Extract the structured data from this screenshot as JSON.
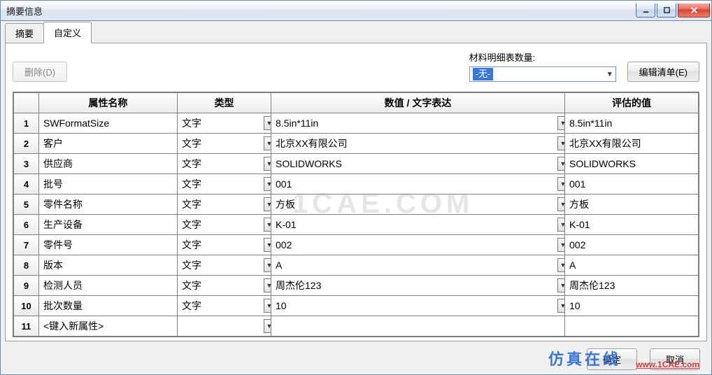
{
  "window": {
    "title": "摘要信息"
  },
  "tabs": {
    "summary": "摘要",
    "custom": "自定义"
  },
  "buttons": {
    "delete": "删除(D)",
    "edit_list": "编辑清单(E)",
    "ok": "确定",
    "cancel": "取消"
  },
  "bom": {
    "label": "材料明细表数量:",
    "value": "-无-"
  },
  "columns": {
    "name": "属性名称",
    "type": "类型",
    "value_expr": "数值 / 文字表达",
    "evaluated": "评估的值"
  },
  "rows": [
    {
      "n": "1",
      "name": "SWFormatSize",
      "type": "文字",
      "val": "8.5in*11in",
      "eval": "8.5in*11in"
    },
    {
      "n": "2",
      "name": "客户",
      "type": "文字",
      "val": "北京XX有限公司",
      "eval": "北京XX有限公司"
    },
    {
      "n": "3",
      "name": "供应商",
      "type": "文字",
      "val": "SOLIDWORKS",
      "eval": "SOLIDWORKS"
    },
    {
      "n": "4",
      "name": "批号",
      "type": "文字",
      "val": "001",
      "eval": "001"
    },
    {
      "n": "5",
      "name": "零件名称",
      "type": "文字",
      "val": "方板",
      "eval": "方板"
    },
    {
      "n": "6",
      "name": "生产设备",
      "type": "文字",
      "val": "K-01",
      "eval": "K-01"
    },
    {
      "n": "7",
      "name": "零件号",
      "type": "文字",
      "val": "002",
      "eval": "002"
    },
    {
      "n": "8",
      "name": "版本",
      "type": "文字",
      "val": "A",
      "eval": "A"
    },
    {
      "n": "9",
      "name": "检测人员",
      "type": "文字",
      "val": "周杰伦123",
      "eval": "周杰伦123"
    },
    {
      "n": "10",
      "name": "批次数量",
      "type": "文字",
      "val": "10",
      "eval": "10"
    },
    {
      "n": "11",
      "name": "<键入新属性>",
      "type": "",
      "val": "",
      "eval": ""
    }
  ],
  "watermark": {
    "center": "1CAE.COM",
    "brand": "仿真在线",
    "url": "www.1CAE.com"
  }
}
